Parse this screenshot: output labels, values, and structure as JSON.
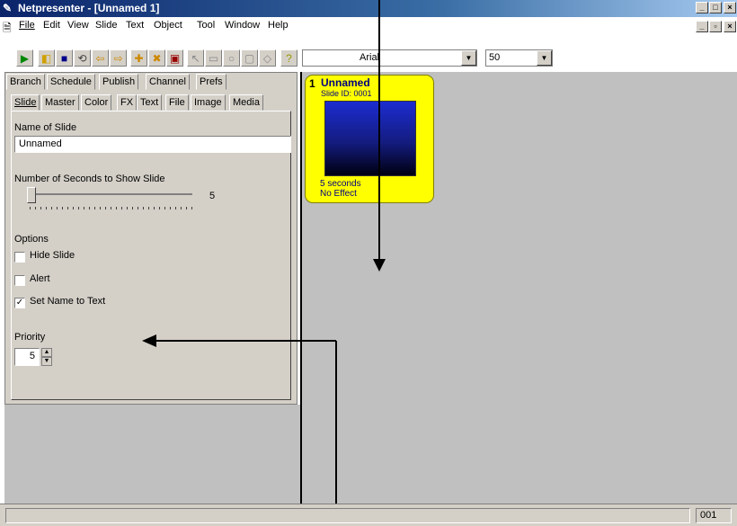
{
  "window": {
    "title": "Netpresenter - [Unnamed 1]"
  },
  "menu": [
    {
      "label": "File"
    },
    {
      "label": "Edit"
    },
    {
      "label": "View"
    },
    {
      "label": "Slide"
    },
    {
      "label": "Text"
    },
    {
      "label": "Object"
    },
    {
      "label": "Tool"
    },
    {
      "label": "Window"
    },
    {
      "label": "Help"
    }
  ],
  "toolbar": {
    "font": "Arial",
    "size": "50"
  },
  "tabs_top": [
    {
      "label": "Branch"
    },
    {
      "label": "Schedule"
    },
    {
      "label": "Publish"
    },
    {
      "label": "Channel"
    },
    {
      "label": "Prefs"
    }
  ],
  "tabs_bottom": [
    {
      "label": "Slide"
    },
    {
      "label": "Master"
    },
    {
      "label": "Color"
    },
    {
      "label": "FX"
    },
    {
      "label": "Text"
    },
    {
      "label": "File"
    },
    {
      "label": "Image"
    },
    {
      "label": "Media"
    }
  ],
  "slide_panel": {
    "name_label": "Name of Slide",
    "name_value": "Unnamed",
    "seconds_label": "Number of Seconds to Show Slide",
    "seconds_value": "5",
    "options_label": "Options",
    "hide_slide": "Hide Slide",
    "alert": "Alert",
    "set_name": "Set Name to Text",
    "priority_label": "Priority",
    "priority_value": "5"
  },
  "options_state": {
    "hide_slide": false,
    "alert": false,
    "set_name_to_text": true
  },
  "slide_card": {
    "number": "1",
    "name": "Unnamed",
    "id": "Slide ID: 0001",
    "duration": "5 seconds",
    "effect": "No Effect"
  },
  "status": {
    "right": "001"
  },
  "colors": {
    "slide_card": "#ffff00",
    "canvas": "#c0c0c0",
    "panel": "#d4d0c8"
  }
}
